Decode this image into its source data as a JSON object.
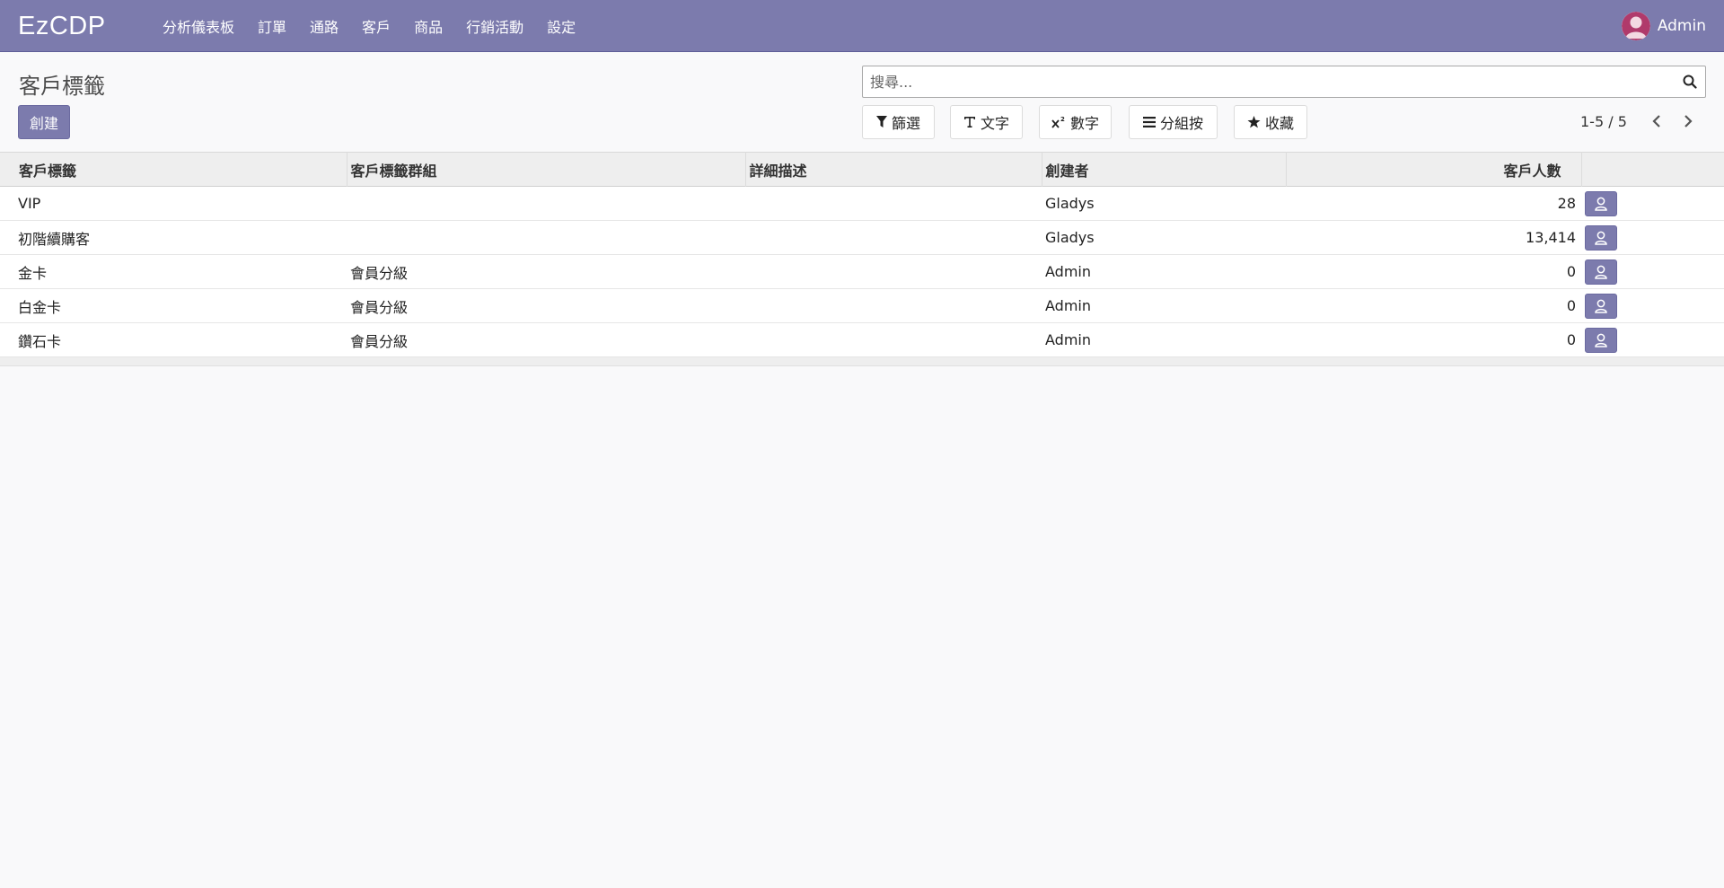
{
  "app": {
    "brand": "EzCDP"
  },
  "navbar": {
    "menu": [
      "分析儀表板",
      "訂單",
      "通路",
      "客戶",
      "商品",
      "行銷活動",
      "設定"
    ],
    "user": "Admin"
  },
  "control": {
    "title": "客戶標籤",
    "create_label": "創建",
    "search_placeholder": "搜尋...",
    "filter_label": "篩選",
    "text_label": "文字",
    "number_label": "數字",
    "groupby_label": "分組按",
    "favorites_label": "收藏",
    "pager": "1-5 / 5"
  },
  "table": {
    "columns": [
      "客戶標籤",
      "客戶標籤群組",
      "詳細描述",
      "創建者",
      "客戶人數"
    ],
    "rows": [
      {
        "tag": "VIP",
        "group": "",
        "desc": "",
        "creator": "Gladys",
        "count": "28"
      },
      {
        "tag": "初階續購客",
        "group": "",
        "desc": "",
        "creator": "Gladys",
        "count": "13,414"
      },
      {
        "tag": "金卡",
        "group": "會員分級",
        "desc": "",
        "creator": "Admin",
        "count": "0"
      },
      {
        "tag": "白金卡",
        "group": "會員分級",
        "desc": "",
        "creator": "Admin",
        "count": "0"
      },
      {
        "tag": "鑽石卡",
        "group": "會員分級",
        "desc": "",
        "creator": "Admin",
        "count": "0"
      }
    ]
  },
  "colors": {
    "primary": "#7c7bad",
    "avatar": "#b03a6b"
  },
  "icons": {
    "search": "search-icon",
    "filter": "filter-icon",
    "text": "text-icon",
    "number": "superscript-icon",
    "groupby": "bars-icon",
    "favorites": "star-icon",
    "prev": "chevron-left-icon",
    "next": "chevron-right-icon",
    "row_action": "user-icon"
  }
}
